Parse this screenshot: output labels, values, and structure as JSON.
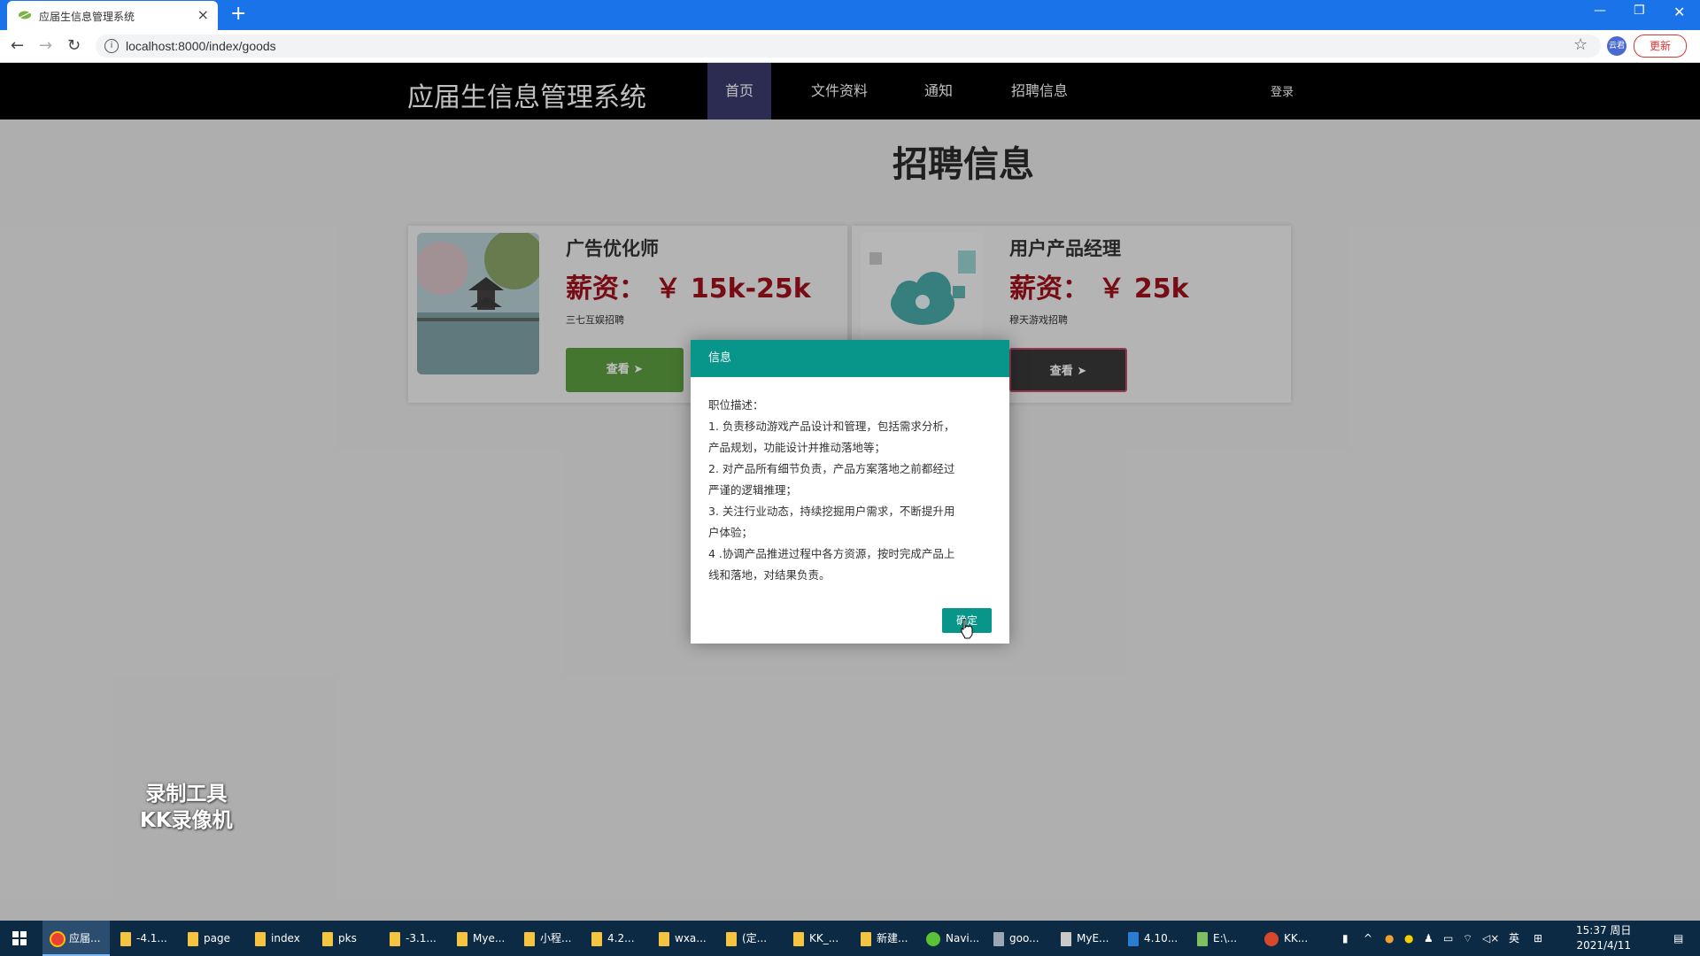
{
  "browser": {
    "tab_title": "应届生信息管理系统",
    "url": "localhost:8000/index/goods",
    "update_label": "更新",
    "profile_label": "云君"
  },
  "site": {
    "logo": "应届生信息管理系统",
    "nav": [
      {
        "label": "首页",
        "active": true
      },
      {
        "label": "文件资料",
        "active": false
      },
      {
        "label": "通知",
        "active": false
      },
      {
        "label": "招聘信息",
        "active": false
      }
    ],
    "login": "登录"
  },
  "main": {
    "section_title": "招聘信息",
    "jobs": [
      {
        "title": "广告优化师",
        "salary": "薪资： ￥ 15k-25k",
        "company": "三七互娱招聘",
        "button": "查看"
      },
      {
        "title": "用户产品经理",
        "salary": "薪资： ￥ 25k",
        "company": "穆天游戏招聘",
        "button": "查看"
      }
    ]
  },
  "modal": {
    "title": "信息",
    "lines": [
      "职位描述：",
      "1. 负责移动游戏产品设计和管理，包括需求分析，",
      "产品规划，功能设计并推动落地等；",
      "2. 对产品所有细节负责，产品方案落地之前都经过",
      "严谨的逻辑推理；",
      "3. 关注行业动态，持续挖掘用户需求，不断提升用",
      "户体验；",
      "4 .协调产品推进过程中各方资源，按时完成产品上",
      "线和落地，对结果负责。"
    ],
    "confirm": "确定"
  },
  "watermark": {
    "line1": "录制工具",
    "line2": "KK录像机"
  },
  "taskbar": {
    "items": [
      "应届...",
      "-4.1...",
      "page",
      "index",
      "pks",
      "-3.1...",
      "Mye...",
      "小程...",
      "4.2...",
      "wxa...",
      "(定...",
      "KK_...",
      "新建...",
      "Navi...",
      "goo...",
      "MyE...",
      "4.10...",
      "E:\\...",
      "KK..."
    ],
    "ime": "英",
    "time": "15:37 周日",
    "date": "2021/4/11"
  },
  "colors": {
    "nav_active": "#3b3a6e",
    "salary": "#a0101b",
    "modal_accent": "#08968b",
    "view_green": "#5c9e3f"
  }
}
